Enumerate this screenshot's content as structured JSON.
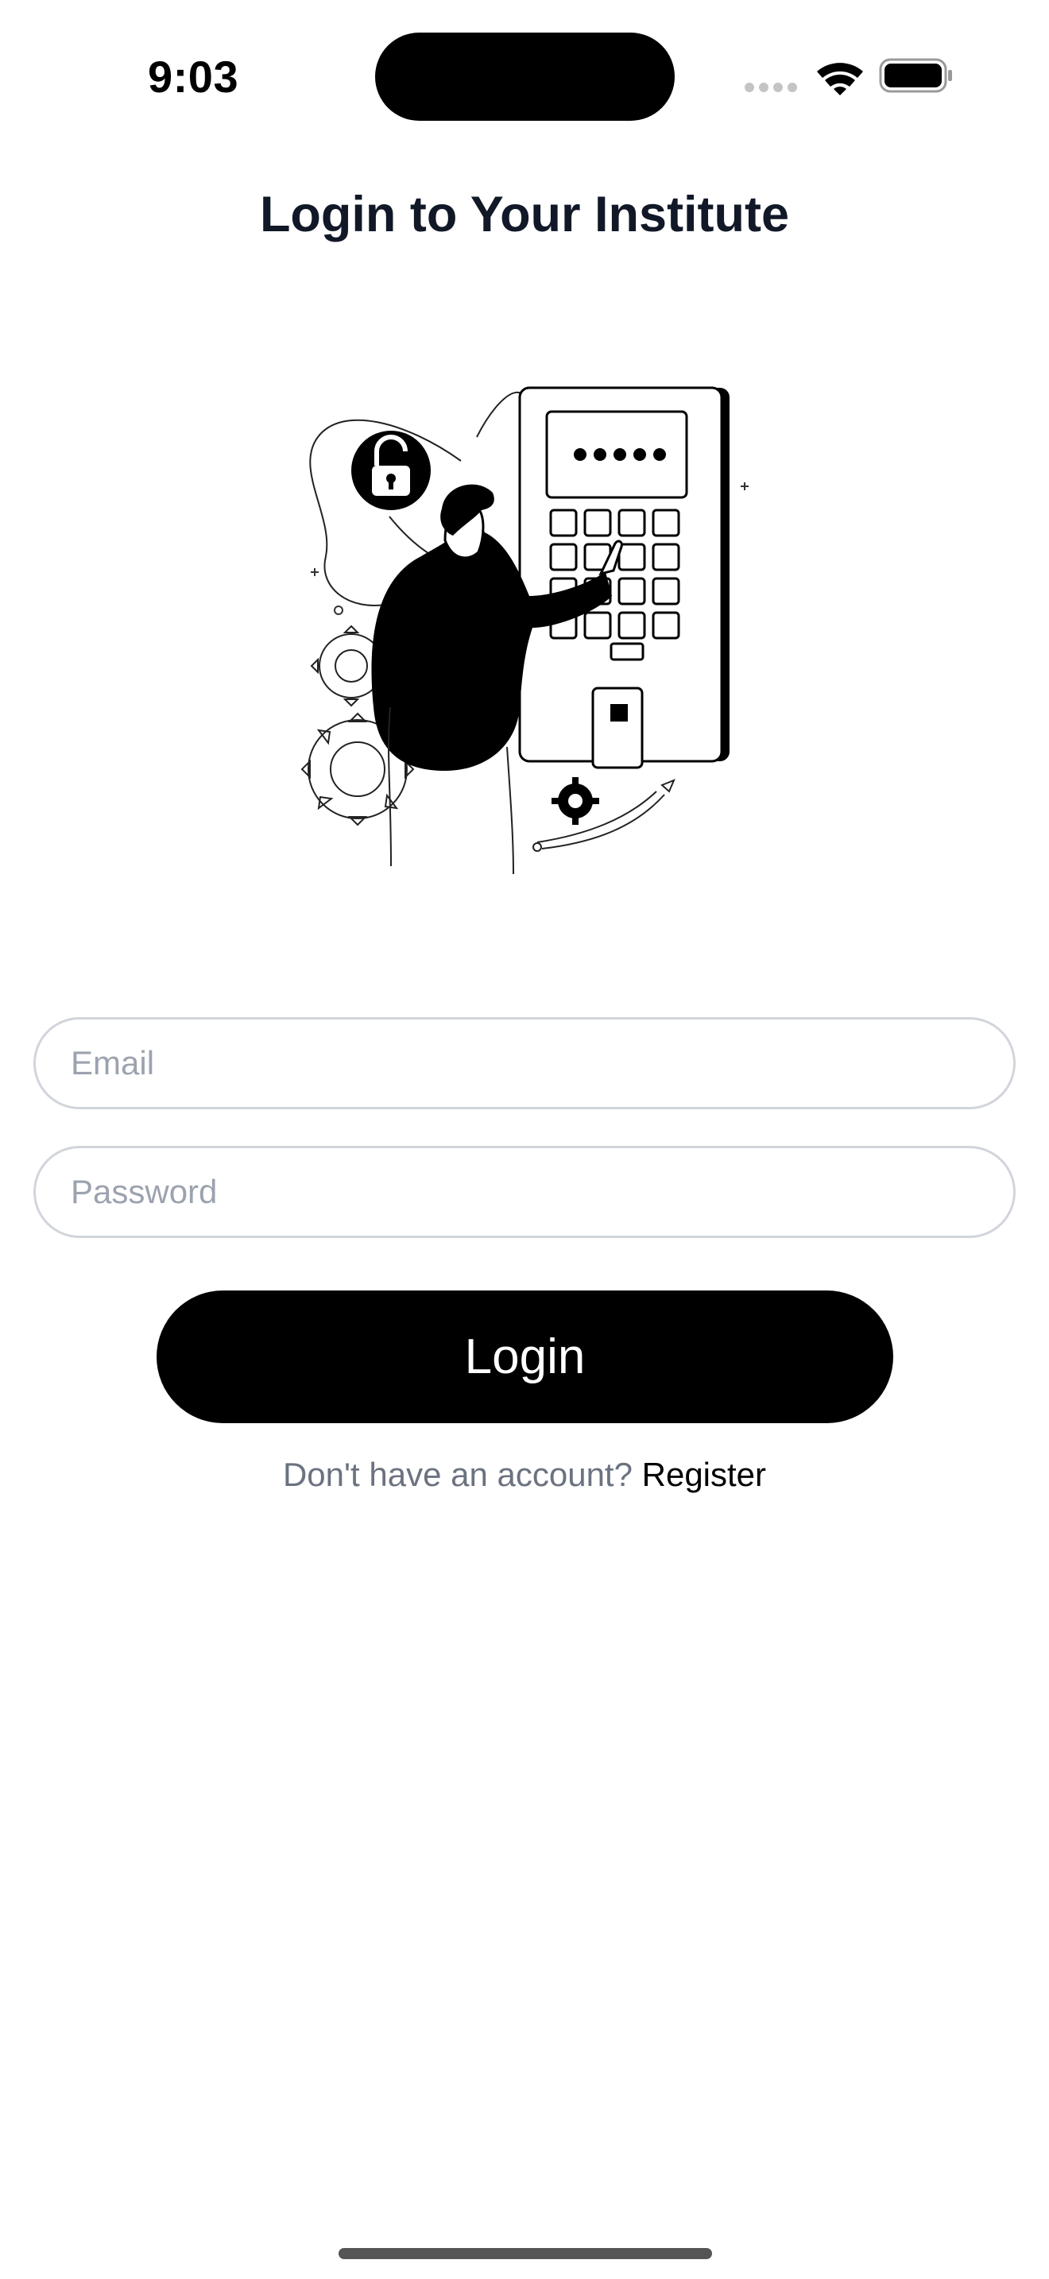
{
  "status_bar": {
    "time": "9:03",
    "icons": [
      "cellular-dots-icon",
      "wifi-icon",
      "battery-icon"
    ]
  },
  "page": {
    "title": "Login to Your Institute"
  },
  "illustration": {
    "icon": "login-illustration",
    "password_mask": "•••••"
  },
  "form": {
    "email_placeholder": "Email",
    "email_value": "",
    "password_placeholder": "Password",
    "password_value": "",
    "login_label": "Login"
  },
  "footer": {
    "prompt": "Don't have an account?",
    "register_label": "Register"
  },
  "colors": {
    "title": "#111827",
    "button": "#000000",
    "field_border": "#d1d5db",
    "placeholder": "#9ca3af",
    "muted_text": "#6b7280"
  }
}
